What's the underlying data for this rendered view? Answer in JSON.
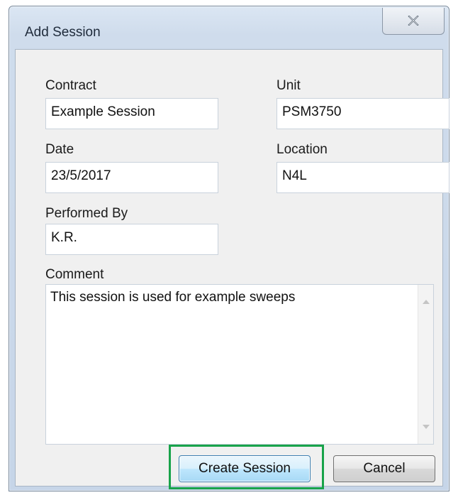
{
  "window": {
    "title": "Add Session",
    "close_icon": "close-icon"
  },
  "form": {
    "contract": {
      "label": "Contract",
      "value": "Example Session"
    },
    "unit": {
      "label": "Unit",
      "value": "PSM3750"
    },
    "date": {
      "label": "Date",
      "value": "23/5/2017"
    },
    "location": {
      "label": "Location",
      "value": "N4L"
    },
    "performed_by": {
      "label": "Performed By",
      "value": "K.R."
    },
    "comment": {
      "label": "Comment",
      "value": "This session is used for example sweeps"
    }
  },
  "buttons": {
    "create": "Create Session",
    "cancel": "Cancel"
  },
  "colors": {
    "highlight": "#18a34a",
    "title_bar": "#cfdcec",
    "client": "#f0f0f0"
  }
}
